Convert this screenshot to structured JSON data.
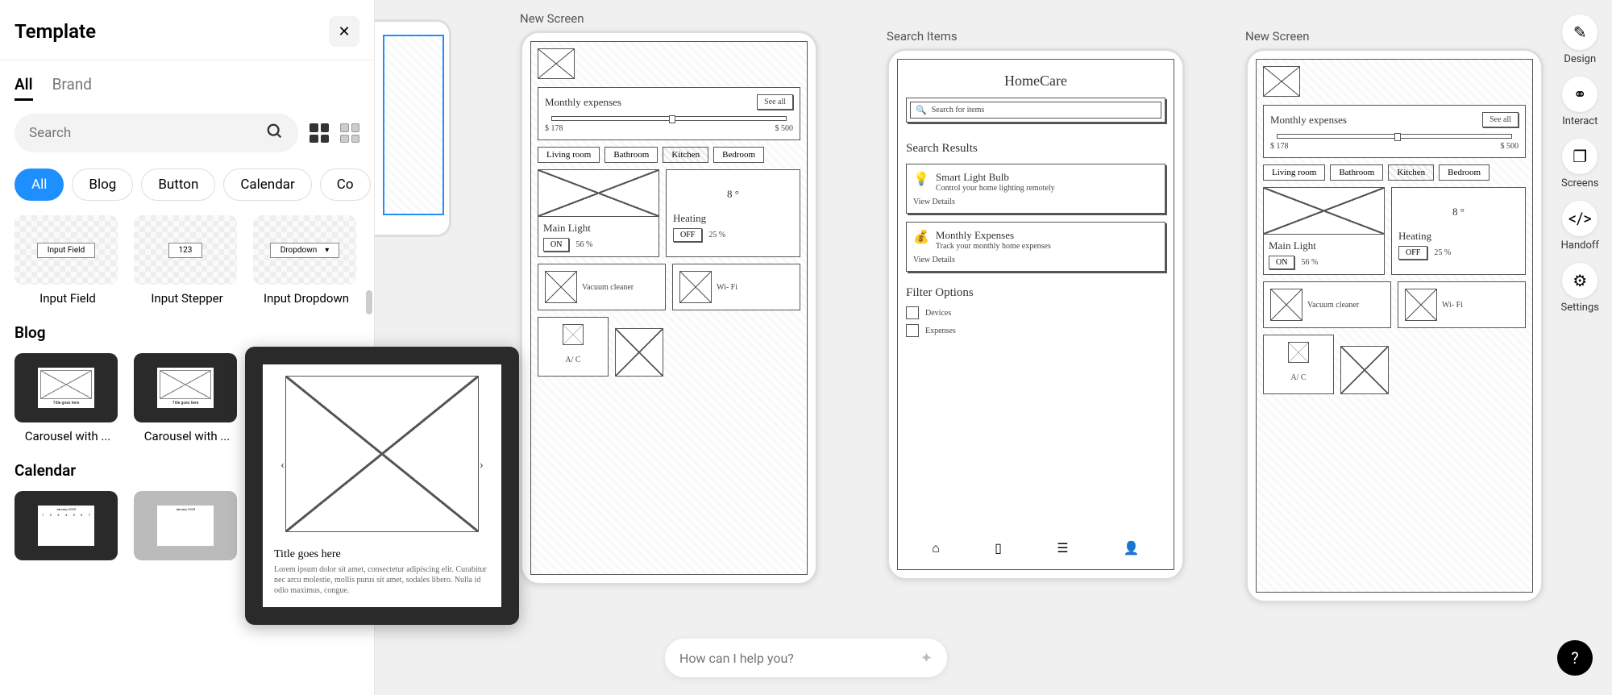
{
  "panel": {
    "title": "Template",
    "tabs": [
      "All",
      "Brand"
    ],
    "search_placeholder": "Search",
    "chips": [
      "All",
      "Blog",
      "Button",
      "Calendar",
      "Co"
    ],
    "input_items": [
      "Input Field",
      "Input Stepper",
      "Input Dropdown"
    ],
    "input_thumbs": [
      "Input Field",
      "123",
      "Dropdown"
    ],
    "blog_title": "Blog",
    "blog_items": [
      "Carousel with ...",
      "Carousel with ..."
    ],
    "calendar_title": "Calendar",
    "floating": {
      "title": "Title goes here",
      "desc": "Lorem ipsum dolor sit amet, consectetur adipiscing elit. Curabitur nec arcu molestie, mollis purus sit amet, sodales libero. Nulla id odio maximus, congue."
    }
  },
  "frames": [
    {
      "label": "New Screen"
    },
    {
      "label": "Search Items"
    },
    {
      "label": "New Screen"
    }
  ],
  "home": {
    "title": "Monthly expenses",
    "see_all": "See all",
    "min": "$ 178",
    "max": "$ 500",
    "rooms": [
      "Living room",
      "Bathroom",
      "Kitchen",
      "Bedroom"
    ],
    "cards": {
      "main_light": "Main Light",
      "on": "ON",
      "pct1": "56 %",
      "heating": "Heating",
      "temp": "8 °",
      "off": "OFF",
      "pct2": "25 %",
      "vacuum": "Vacuum cleaner",
      "wifi": "Wi- Fi",
      "ac": "A/ C"
    }
  },
  "search": {
    "app": "HomeCare",
    "placeholder": "Search for items",
    "results_title": "Search Results",
    "r1": {
      "t": "Smart Light Bulb",
      "d": "Control your home lighting remotely",
      "v": "View Details"
    },
    "r2": {
      "t": "Monthly Expenses",
      "d": "Track your monthly home expenses",
      "v": "View Details"
    },
    "filter_title": "Filter Options",
    "f1": "Devices",
    "f2": "Expenses"
  },
  "tools": [
    "Design",
    "Interact",
    "Screens",
    "Handoff",
    "Settings"
  ],
  "ai_placeholder": "How can I help you?"
}
